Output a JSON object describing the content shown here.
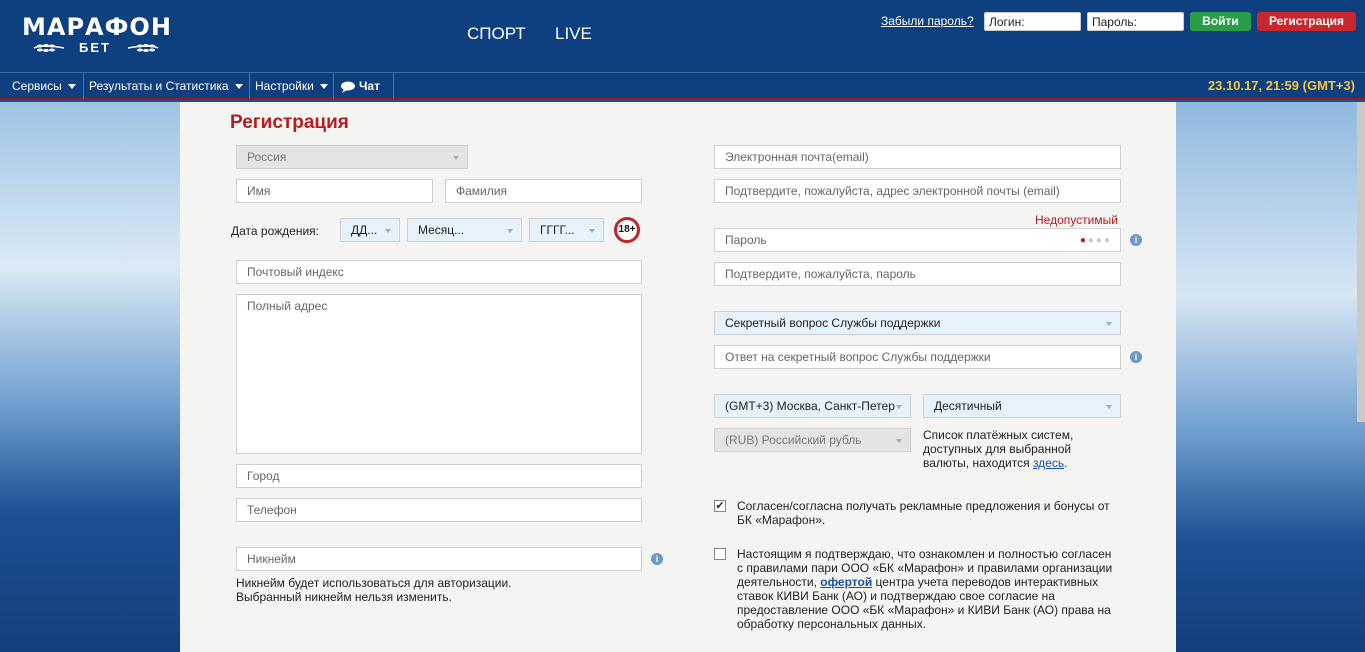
{
  "header": {
    "logo_main": "МАРАФОН",
    "logo_sub": "БЕТ",
    "nav": [
      "СПОРТ",
      "LIVE"
    ],
    "forgot_password": "Забыли пароль?",
    "login_placeholder": "Логин:",
    "password_placeholder": "Пароль:",
    "login_button": "Войти",
    "register_button": "Регистрация"
  },
  "menu": {
    "items": [
      "Сервисы",
      "Результаты и Статистика",
      "Настройки",
      "Чат"
    ],
    "datetime": "23.10.17, 21:59 (GMT+3)"
  },
  "form": {
    "title": "Регистрация",
    "country": "Россия",
    "first_name": "Имя",
    "last_name": "Фамилия",
    "dob_label": "Дата рождения:",
    "dob_day": "ДД...",
    "dob_month": "Месяц...",
    "dob_year": "ГГГГ...",
    "age_badge": "18+",
    "postal": "Почтовый индекс",
    "address": "Полный адрес",
    "city": "Город",
    "phone": "Телефон",
    "nickname": "Никнейм",
    "nickname_note_1": "Никнейм будет использоваться для авторизации.",
    "nickname_note_2": "Выбранный никнейм нельзя изменить.",
    "email": "Электронная почта(email)",
    "email_confirm": "Подтвердите, пожалуйста, адрес электронной почты (email)",
    "password_error": "Недопустимый",
    "password": "Пароль",
    "password_confirm": "Подтвердите, пожалуйста, пароль",
    "secret_question": "Секретный вопрос Службы поддержки",
    "secret_answer": "Ответ на секретный вопрос Службы поддержки",
    "timezone": "(GMT+3) Москва, Санкт-Петер",
    "odds_format": "Десятичный",
    "currency": "(RUB) Российский рубль",
    "payment_note_1": "Список платёжных систем,",
    "payment_note_2": "доступных для выбранной",
    "payment_note_3": "валюты, находится",
    "payment_link": "здесь",
    "payment_end": ".",
    "promo_line_1": "Согласен/согласна получать рекламные предложения и бонусы от",
    "promo_line_2": "БК «Марафон».",
    "terms_line_1": "Настоящим я подтверждаю, что ознакомлен и полностью согласен",
    "terms_line_2": "с правилами пари ООО «БК «Марафон» и правилами организации",
    "terms_line_3a": "деятельности,",
    "terms_link": "офертой",
    "terms_line_3b": "центра учета переводов интерактивных",
    "terms_line_4": "ставок КИВИ Банк (АО) и подтверждаю свое согласие на",
    "terms_line_5": "предоставление ООО «БК «Марафон» и КИВИ Банк (АО) права на",
    "terms_line_6": "обработку персональных данных.",
    "check_mark": "✔",
    "info_glyph": "i",
    "password_dots": "●●●●"
  },
  "colors": {
    "header_bg": "#0e3f7f",
    "accent_red": "#b21d22",
    "login_green": "#2a9d48",
    "register_red": "#c8272d",
    "datetime_yellow": "#f4c63d"
  }
}
